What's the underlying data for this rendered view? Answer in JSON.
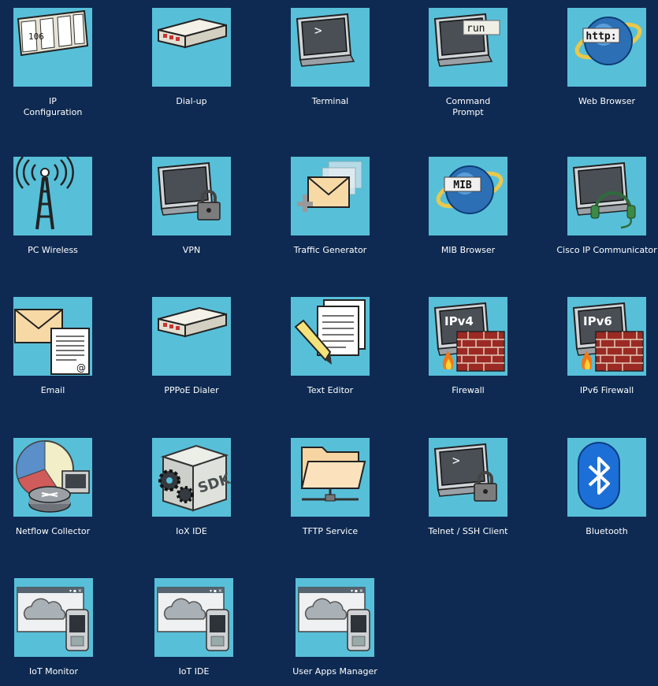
{
  "apps": [
    {
      "label": "IP\nConfiguration",
      "icon": "ip-config-icon",
      "name": "ip-configuration",
      "tag": "106"
    },
    {
      "label": "Dial-up",
      "icon": "modem-icon",
      "name": "dial-up"
    },
    {
      "label": "Terminal",
      "icon": "terminal-icon",
      "name": "terminal"
    },
    {
      "label": "Command\nPrompt",
      "icon": "command-prompt-icon",
      "name": "command-prompt",
      "tag": "run"
    },
    {
      "label": "Web Browser",
      "icon": "globe-icon",
      "name": "web-browser",
      "tag": "http:"
    },
    {
      "label": "PC Wireless",
      "icon": "wireless-tower-icon",
      "name": "pc-wireless"
    },
    {
      "label": "VPN",
      "icon": "monitor-lock-icon",
      "name": "vpn"
    },
    {
      "label": "Traffic Generator",
      "icon": "envelopes-icon",
      "name": "traffic-generator"
    },
    {
      "label": "MIB Browser",
      "icon": "mib-globe-icon",
      "name": "mib-browser",
      "tag": "MIB"
    },
    {
      "label": "Cisco IP Communicator",
      "icon": "monitor-headset-icon",
      "name": "cisco-ip-communicator"
    },
    {
      "label": "Email",
      "icon": "email-icon",
      "name": "email"
    },
    {
      "label": "PPPoE Dialer",
      "icon": "modem-icon",
      "name": "pppoe-dialer"
    },
    {
      "label": "Text Editor",
      "icon": "document-pencil-icon",
      "name": "text-editor"
    },
    {
      "label": "Firewall",
      "icon": "firewall-icon",
      "name": "firewall",
      "tag": "IPv4"
    },
    {
      "label": "IPv6 Firewall",
      "icon": "firewall-icon",
      "name": "ipv6-firewall",
      "tag": "IPv6"
    },
    {
      "label": "Netflow Collector",
      "icon": "pie-chart-router-icon",
      "name": "netflow-collector"
    },
    {
      "label": "IoX IDE",
      "icon": "sdk-box-icon",
      "name": "iox-ide",
      "tag": "SDK"
    },
    {
      "label": "TFTP Service",
      "icon": "folder-network-icon",
      "name": "tftp-service"
    },
    {
      "label": "Telnet / SSH Client",
      "icon": "terminal-lock-icon",
      "name": "telnet-ssh-client"
    },
    {
      "label": "Bluetooth",
      "icon": "bluetooth-icon",
      "name": "bluetooth"
    },
    {
      "label": "IoT Monitor",
      "icon": "cloud-phone-icon",
      "name": "iot-monitor"
    },
    {
      "label": "IoT IDE",
      "icon": "cloud-phone-icon",
      "name": "iot-ide"
    },
    {
      "label": "User Apps Manager",
      "icon": "cloud-phone-icon",
      "name": "user-apps-manager"
    }
  ]
}
